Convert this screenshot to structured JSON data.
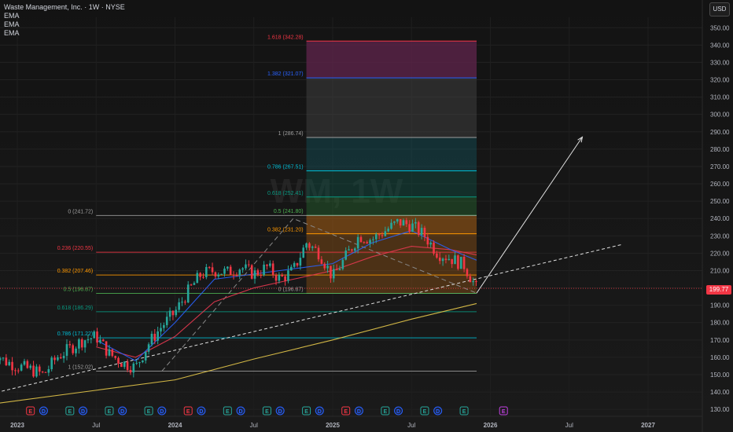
{
  "header": {
    "title": "Waste Management, Inc. · 1W · NYSE",
    "indicators": [
      "EMA",
      "EMA",
      "EMA"
    ],
    "currency": "USD",
    "watermark": "WM, 1W"
  },
  "last_price": "199.77",
  "colors": {
    "up": "#26a69a",
    "down": "#f23645",
    "ema_fast": "#2962ff",
    "ema_mid": "#e53950",
    "ema_slow": "#e6c84a",
    "trend": "#e0e0e0"
  },
  "chart_data": {
    "type": "candlestick",
    "x_axis": {
      "labels": [
        "2023",
        "Jul",
        "2024",
        "Jul",
        "2025",
        "Jul",
        "2026",
        "Jul",
        "2027"
      ],
      "label_positions": [
        "2023-01",
        "2023-07",
        "2024-01",
        "2024-07",
        "2025-01",
        "2025-07",
        "2026-01",
        "2026-07",
        "2027-01"
      ]
    },
    "y_axis": {
      "range": [
        126,
        356
      ],
      "ticks": [
        130,
        140,
        150,
        160,
        170,
        180,
        190,
        200,
        210,
        220,
        230,
        240,
        250,
        260,
        270,
        280,
        290,
        300,
        310,
        320,
        330,
        340,
        350
      ]
    },
    "price_anchors": [
      [
        "2022-11",
        165
      ],
      [
        "2022-12",
        158
      ],
      [
        "2023-01",
        155
      ],
      [
        "2023-02",
        153
      ],
      [
        "2023-03",
        150
      ],
      [
        "2023-04",
        160
      ],
      [
        "2023-05",
        165
      ],
      [
        "2023-06",
        170
      ],
      [
        "2023-07",
        172
      ],
      [
        "2023-08",
        162
      ],
      [
        "2023-09",
        157
      ],
      [
        "2023-10",
        154
      ],
      [
        "2023-11",
        168
      ],
      [
        "2023-12",
        178
      ],
      [
        "2024-01",
        186
      ],
      [
        "2024-02",
        198
      ],
      [
        "2024-03",
        208
      ],
      [
        "2024-04",
        210
      ],
      [
        "2024-05",
        209
      ],
      [
        "2024-06",
        212
      ],
      [
        "2024-07",
        208
      ],
      [
        "2024-08",
        212
      ],
      [
        "2024-09",
        205
      ],
      [
        "2024-10",
        210
      ],
      [
        "2024-11",
        226
      ],
      [
        "2024-12",
        220
      ],
      [
        "2025-01",
        206
      ],
      [
        "2025-02",
        218
      ],
      [
        "2025-03",
        230
      ],
      [
        "2025-04",
        228
      ],
      [
        "2025-05",
        233
      ],
      [
        "2025-06",
        238
      ],
      [
        "2025-07",
        236
      ],
      [
        "2025-08",
        230
      ],
      [
        "2025-09",
        220
      ],
      [
        "2025-10",
        217
      ],
      [
        "2025-11",
        213
      ],
      [
        "2025-11-30",
        199.77
      ]
    ],
    "ema_fast": [
      [
        "2023-07",
        170
      ],
      [
        "2023-10",
        158
      ],
      [
        "2024-01",
        180
      ],
      [
        "2024-04",
        205
      ],
      [
        "2024-07",
        208
      ],
      [
        "2024-10",
        211
      ],
      [
        "2025-01",
        214
      ],
      [
        "2025-04",
        226
      ],
      [
        "2025-07",
        233
      ],
      [
        "2025-10",
        222
      ],
      [
        "2025-11-30",
        216
      ]
    ],
    "ema_mid": [
      [
        "2023-07",
        166
      ],
      [
        "2023-10",
        160
      ],
      [
        "2024-01",
        172
      ],
      [
        "2024-04",
        192
      ],
      [
        "2024-07",
        200
      ],
      [
        "2024-10",
        205
      ],
      [
        "2025-01",
        210
      ],
      [
        "2025-04",
        218
      ],
      [
        "2025-07",
        224
      ],
      [
        "2025-10",
        222
      ],
      [
        "2025-11-30",
        219
      ]
    ],
    "ema_slow": [
      [
        "2022-11",
        133
      ],
      [
        "2023-07",
        141
      ],
      [
        "2024-01",
        147
      ],
      [
        "2024-07",
        159
      ],
      [
        "2025-01",
        170
      ],
      [
        "2025-07",
        182
      ],
      [
        "2025-11-30",
        191
      ]
    ],
    "fib_retracement": {
      "x_start": "2023-07",
      "x_end": "2025-11-30",
      "levels": [
        {
          "label": "0 (241.72)",
          "value": 241.72,
          "color": "#9e9e9e"
        },
        {
          "label": "0.236 (220.55)",
          "value": 220.55,
          "color": "#f23645"
        },
        {
          "label": "0.382 (207.46)",
          "value": 207.46,
          "color": "#ff9800"
        },
        {
          "label": "0.5 (196.87)",
          "value": 196.87,
          "color": "#4caf50"
        },
        {
          "label": "0.618 (186.29)",
          "value": 186.29,
          "color": "#089981"
        },
        {
          "label": "0.786 (171.22)",
          "value": 171.22,
          "color": "#00bcd4"
        },
        {
          "label": "1 (152.02)",
          "value": 152.02,
          "color": "#9e9e9e"
        }
      ]
    },
    "fib_extension": {
      "x_start": "2024-11",
      "x_end": "2025-11-30",
      "levels": [
        {
          "label": "1.618 (342.28)",
          "value": 342.28,
          "color": "#f23645",
          "fill": "rgba(142,25,40,0.45)"
        },
        {
          "label": "1.382 (321.07)",
          "value": 321.07,
          "color": "#2962ff",
          "fill": "rgba(30,55,130,0.55)"
        },
        {
          "label": "1 (286.74)",
          "value": 286.74,
          "color": "#9e9e9e",
          "fill": "rgba(70,70,70,0.45)"
        },
        {
          "label": "0.786 (267.51)",
          "value": 267.51,
          "color": "#00bcd4",
          "fill": "rgba(20,90,100,0.40)"
        },
        {
          "label": "0.618 (252.41)",
          "value": 252.41,
          "color": "#089981",
          "fill": "rgba(15,95,80,0.35)"
        },
        {
          "label": "0.5 (241.80)",
          "value": 241.8,
          "color": "#4caf50",
          "fill": "rgba(40,110,50,0.40)"
        },
        {
          "label": "0.382 (231.20)",
          "value": 231.2,
          "color": "#ff9800",
          "fill": "rgba(200,110,20,0.45)"
        },
        {
          "label": "0 (196.87)",
          "value": 196.87,
          "color": "#9e9e9e",
          "fill": "rgba(200,110,20,0.30)"
        }
      ]
    },
    "trendline": {
      "from": [
        "2022-11",
        139
      ],
      "to": [
        "2026-11",
        225
      ]
    },
    "dashed_path": [
      [
        "2023-12",
        152
      ],
      [
        "2024-10",
        240
      ],
      [
        "2025-11-30",
        197
      ]
    ],
    "projection_arrow": {
      "from": [
        "2025-11-30",
        197
      ],
      "to": [
        "2026-08",
        287
      ]
    },
    "events": [
      {
        "t": "2022-11",
        "kind": "D"
      },
      {
        "t": "2023-02",
        "kind": "E"
      },
      {
        "t": "2023-03",
        "kind": "D"
      },
      {
        "t": "2023-05",
        "kind": "E"
      },
      {
        "t": "2023-06",
        "kind": "D"
      },
      {
        "t": "2023-08",
        "kind": "E"
      },
      {
        "t": "2023-09",
        "kind": "D"
      },
      {
        "t": "2023-11",
        "kind": "E"
      },
      {
        "t": "2023-12",
        "kind": "D"
      },
      {
        "t": "2024-02",
        "kind": "E"
      },
      {
        "t": "2024-03",
        "kind": "D"
      },
      {
        "t": "2024-05",
        "kind": "E"
      },
      {
        "t": "2024-06",
        "kind": "D"
      },
      {
        "t": "2024-08",
        "kind": "E"
      },
      {
        "t": "2024-09",
        "kind": "D"
      },
      {
        "t": "2024-11",
        "kind": "E"
      },
      {
        "t": "2024-12",
        "kind": "D"
      },
      {
        "t": "2025-02",
        "kind": "E"
      },
      {
        "t": "2025-03",
        "kind": "D"
      },
      {
        "t": "2025-05",
        "kind": "E"
      },
      {
        "t": "2025-06",
        "kind": "D"
      },
      {
        "t": "2025-08",
        "kind": "E"
      },
      {
        "t": "2025-09",
        "kind": "D"
      },
      {
        "t": "2025-11",
        "kind": "E"
      },
      {
        "t": "2026-02",
        "kind": "E"
      }
    ]
  }
}
